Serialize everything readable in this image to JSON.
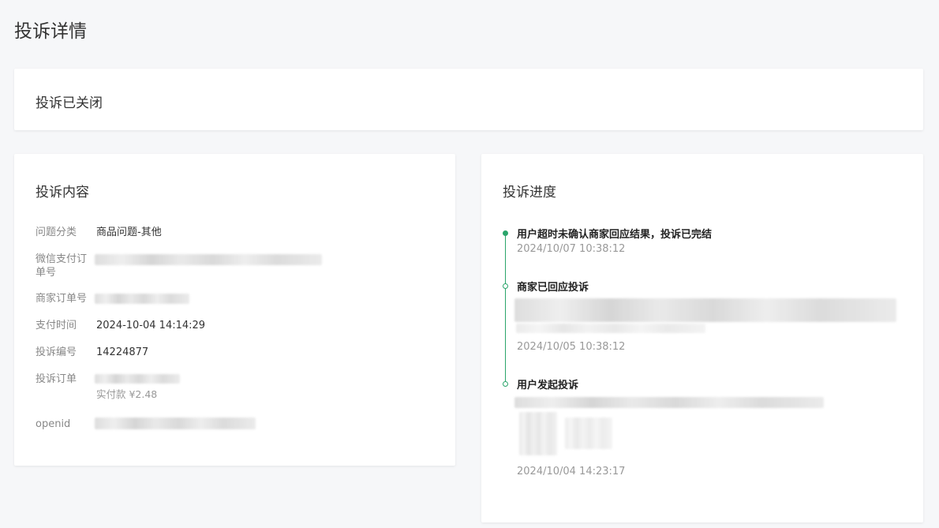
{
  "page_title": "投诉详情",
  "status": {
    "text": "投诉已关闭"
  },
  "content": {
    "title": "投诉内容",
    "fields": {
      "category": {
        "label": "问题分类",
        "value": "商品问题-其他"
      },
      "wechat_order": {
        "label": "微信支付订单号"
      },
      "merchant_order": {
        "label": "商家订单号"
      },
      "pay_time": {
        "label": "支付时间",
        "value": "2024-10-04 14:14:29"
      },
      "complaint_no": {
        "label": "投诉编号",
        "value": "14224877"
      },
      "complaint_order": {
        "label": "投诉订单",
        "paid_amount": "实付款 ¥2.48"
      },
      "openid": {
        "label": "openid"
      }
    }
  },
  "progress": {
    "title": "投诉进度",
    "events": [
      {
        "title": "用户超时未确认商家回应结果，投诉已完结",
        "time": "2024/10/07 10:38:12"
      },
      {
        "title": "商家已回应投诉",
        "time": "2024/10/05 10:38:12"
      },
      {
        "title": "用户发起投诉",
        "time": "2024/10/04 14:23:17"
      }
    ]
  },
  "colors": {
    "accent": "#2aa56b",
    "background": "#f6f7f9"
  }
}
